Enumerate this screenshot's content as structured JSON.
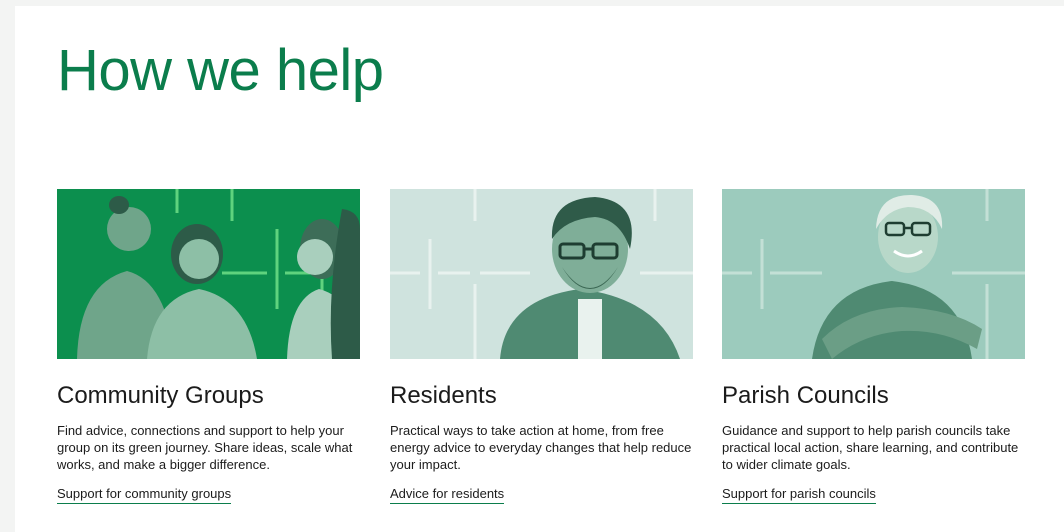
{
  "heading": "How we help",
  "cards": [
    {
      "title": "Community Groups",
      "description": "Find advice, connections and support to help your group on its green journey. Share ideas, scale what works, and make a bigger difference.",
      "link": "Support for community groups",
      "image_bg": "#0c8f4e"
    },
    {
      "title": "Residents",
      "description": "Practical ways to take action at home, from free energy advice to everyday changes that help reduce your impact.",
      "link": "Advice for residents",
      "image_bg": "#cfe3de"
    },
    {
      "title": "Parish Councils",
      "description": "Guidance and support to help parish councils take practical local action, share learning, and contribute to wider climate goals.",
      "link": "Support for parish councils",
      "image_bg": "#9ccbbd"
    }
  ]
}
